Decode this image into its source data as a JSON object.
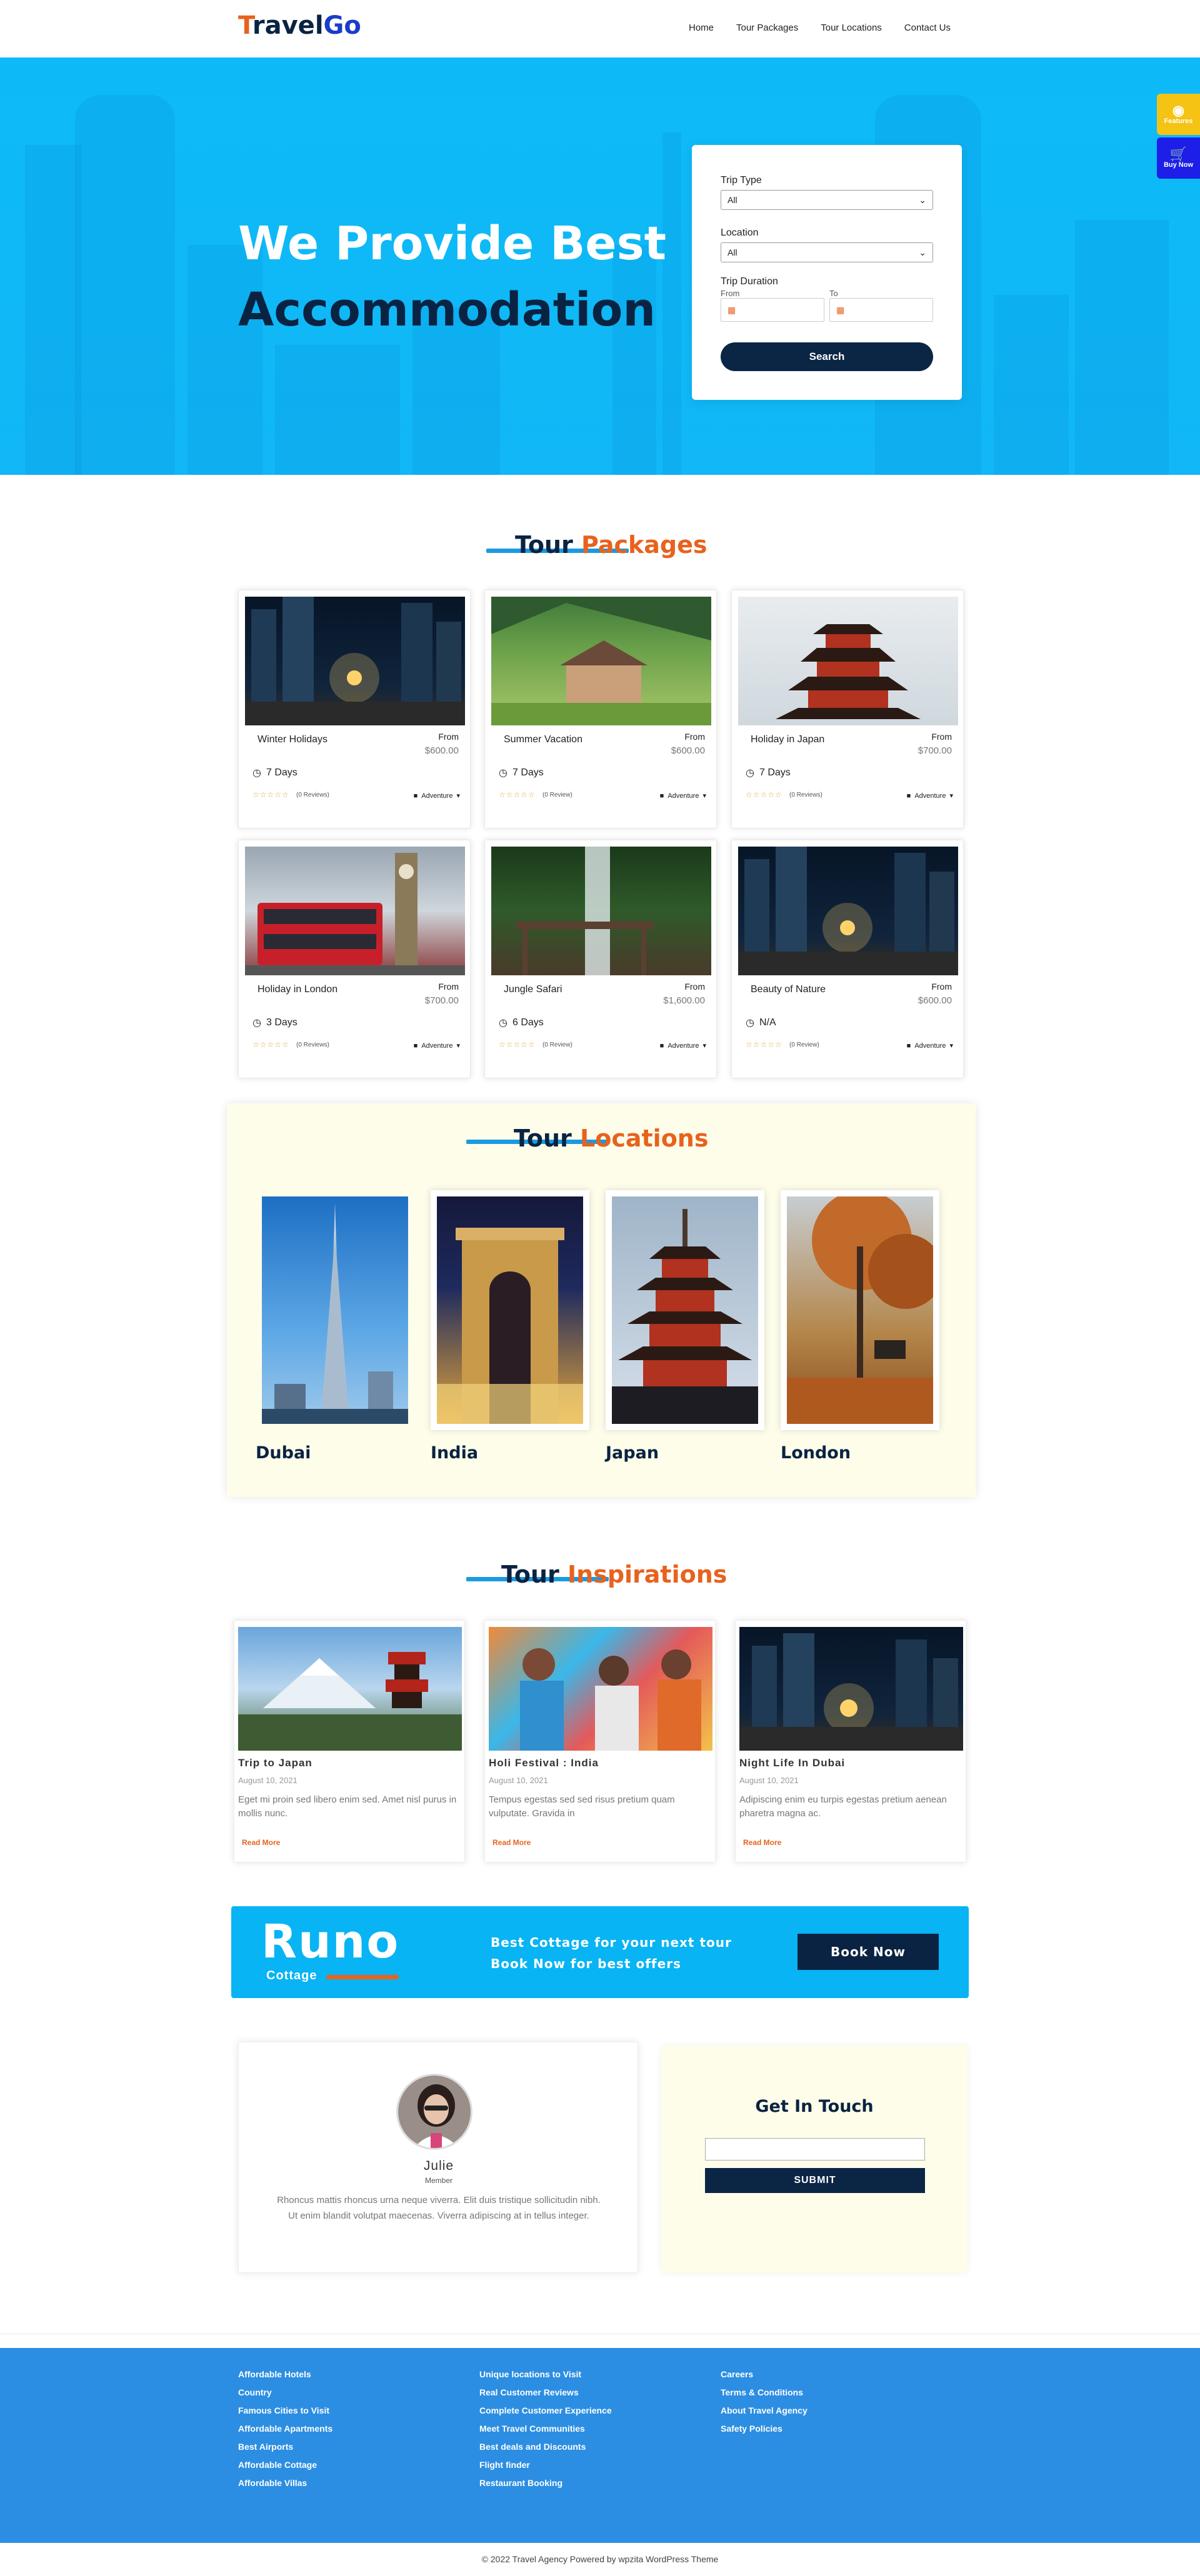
{
  "header": {
    "logo_t": "T",
    "logo_ravel": "ravel",
    "logo_go": "Go",
    "nav": [
      "Home",
      "Tour Packages",
      "Tour Locations",
      "Contact Us"
    ]
  },
  "hero": {
    "title_line1": "We Provide Best",
    "title_line2": "Accommodation",
    "search": {
      "trip_type_label": "Trip Type",
      "trip_type_value": "All",
      "location_label": "Location",
      "location_value": "All",
      "duration_label": "Trip Duration",
      "from_label": "From",
      "to_label": "To",
      "search_button": "Search"
    },
    "side_features": "Features",
    "side_buy": "Buy Now"
  },
  "packages": {
    "title_w1": "Tour",
    "title_w2": "Packages",
    "items": [
      {
        "name": "Winter Holidays",
        "from": "From",
        "price": "$600.00",
        "days": "7 Days",
        "reviews": "(0 Reviews)",
        "tag": "Adventure",
        "stars": "☆☆☆☆☆"
      },
      {
        "name": "Summer Vacation",
        "from": "From",
        "price": "$600.00",
        "days": "7 Days",
        "reviews": "(0 Review)",
        "tag": "Adventure",
        "stars": "☆☆☆☆☆"
      },
      {
        "name": "Holiday in Japan",
        "from": "From",
        "price": "$700.00",
        "days": "7 Days",
        "reviews": "(0 Reviews)",
        "tag": "Adventure",
        "stars": "☆☆☆☆☆"
      },
      {
        "name": "Holiday in London",
        "from": "From",
        "price": "$700.00",
        "days": "3 Days",
        "reviews": "(0 Reviews)",
        "tag": "Adventure",
        "stars": "☆☆☆☆☆"
      },
      {
        "name": "Jungle Safari",
        "from": "From",
        "price": "$1,600.00",
        "days": "6 Days",
        "reviews": "(0 Review)",
        "tag": "Adventure",
        "stars": "☆☆☆☆☆"
      },
      {
        "name": "Beauty of Nature",
        "from": "From",
        "price": "$600.00",
        "days": "N/A",
        "reviews": "(0 Review)",
        "tag": "Adventure",
        "stars": "☆☆☆☆☆"
      }
    ]
  },
  "locations": {
    "title_w1": "Tour",
    "title_w2": "Locations",
    "items": [
      "Dubai",
      "India",
      "Japan",
      "London"
    ]
  },
  "inspirations": {
    "title_w1": "Tour",
    "title_w2": "Inspirations",
    "items": [
      {
        "title": "Trip to Japan",
        "date": "August 10, 2021",
        "text": "Eget mi proin sed libero enim sed. Amet nisl purus in mollis nunc.",
        "more": "Read More"
      },
      {
        "title": "Holi Festival : India",
        "date": "August 10, 2021",
        "text": "Tempus egestas sed sed risus pretium quam vulputate. Gravida in",
        "more": "Read More"
      },
      {
        "title": "Night Life In Dubai",
        "date": "August 10, 2021",
        "text": "Adipiscing enim eu turpis egestas pretium aenean pharetra magna ac.",
        "more": "Read More"
      }
    ]
  },
  "banner": {
    "brand": "Runo",
    "brand_sub": "Cottage",
    "line1": "Best Cottage for your next tour",
    "line2": "Book Now for best offers",
    "button": "Book Now"
  },
  "testimonial": {
    "name": "Julie",
    "role": "Member",
    "text": "Rhoncus mattis rhoncus urna neque viverra. Elit duis tristique sollicitudin nibh. Ut enim blandit volutpat maecenas. Viverra adipiscing at in tellus integer."
  },
  "contact": {
    "title": "Get In Touch",
    "button": "SUBMIT"
  },
  "footer": {
    "col1": [
      "Affordable Hotels",
      "Country",
      "Famous Cities to Visit",
      "Affordable Apartments",
      "Best Airports",
      "Affordable Cottage",
      "Affordable Villas"
    ],
    "col2": [
      "Unique locations to Visit",
      "Real Customer Reviews",
      "Complete Customer Experience",
      "Meet Travel Communities",
      "Best deals and Discounts",
      "Flight finder",
      "Restaurant Booking"
    ],
    "col3": [
      "Careers",
      "Terms & Conditions",
      "About Travel Agency",
      "Safety Policies"
    ],
    "copyright": "© 2022 Travel Agency Powered by wpzita WordPress Theme"
  },
  "colors": {
    "brand_orange": "#e8621d",
    "navy": "#0a2342",
    "hero_blue": "#0dbaf7",
    "footer_blue": "#2c8ee2",
    "cream": "#fefdea"
  }
}
